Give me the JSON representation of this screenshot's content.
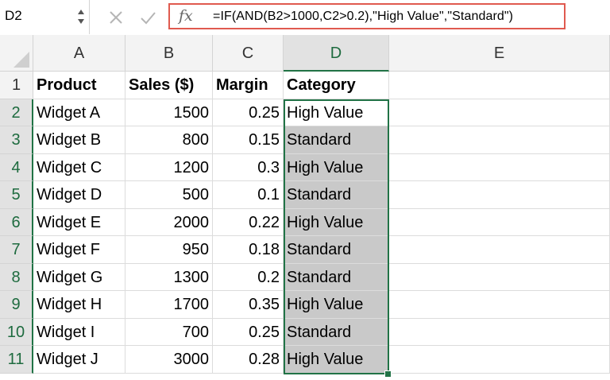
{
  "formula_bar": {
    "name_box": "D2",
    "fx_label": "fx",
    "formula": "=IF(AND(B2>1000,C2>0.2),\"High Value\",\"Standard\")"
  },
  "columns": [
    "A",
    "B",
    "C",
    "D",
    "E"
  ],
  "rows": [
    "1",
    "2",
    "3",
    "4",
    "5",
    "6",
    "7",
    "8",
    "9",
    "10",
    "11"
  ],
  "header_row": [
    "Product",
    "Sales ($)",
    "Margin",
    "Category"
  ],
  "data_rows": [
    [
      "Widget A",
      "1500",
      "0.25",
      "High Value"
    ],
    [
      "Widget B",
      "800",
      "0.15",
      "Standard"
    ],
    [
      "Widget C",
      "1200",
      "0.3",
      "High Value"
    ],
    [
      "Widget D",
      "500",
      "0.1",
      "Standard"
    ],
    [
      "Widget E",
      "2000",
      "0.22",
      "High Value"
    ],
    [
      "Widget F",
      "950",
      "0.18",
      "Standard"
    ],
    [
      "Widget G",
      "1300",
      "0.2",
      "Standard"
    ],
    [
      "Widget H",
      "1700",
      "0.35",
      "High Value"
    ],
    [
      "Widget I",
      "700",
      "0.25",
      "Standard"
    ],
    [
      "Widget J",
      "3000",
      "0.28",
      "High Value"
    ]
  ],
  "colors": {
    "selection": "#217346",
    "formula_highlight": "#e05a4f",
    "selected_cell_fill": "#c9c9c9"
  }
}
